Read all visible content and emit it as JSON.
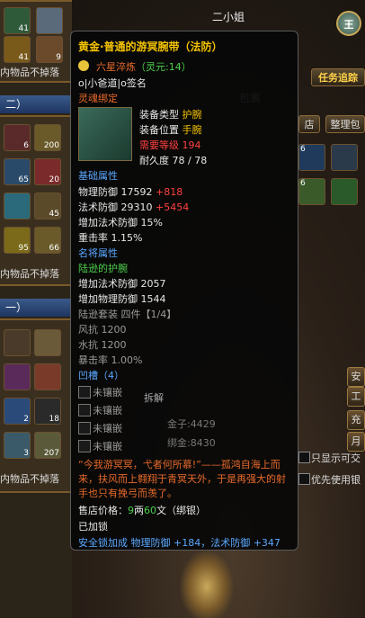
{
  "left": {
    "slots_top": [
      {
        "n": "41"
      },
      {
        "n": "9"
      },
      {
        "n": ""
      }
    ],
    "no_loss_label_1": "内物品不掉落",
    "section_2_title": "二）",
    "slots_mid": [
      {
        "n": "6"
      },
      {
        "n": "200"
      },
      {
        "n": "65"
      },
      {
        "n": "20"
      },
      {
        "n": "45"
      },
      {
        "n": "95"
      },
      {
        "n": "66"
      }
    ],
    "no_loss_label_2": "内物品不掉落",
    "section_1_title": "一）",
    "slots_low": [
      {
        "n": ""
      },
      {
        "n": ""
      },
      {
        "n": ""
      },
      {
        "n": ""
      },
      {
        "n": "2"
      },
      {
        "n": "18"
      },
      {
        "n": "3"
      },
      {
        "n": "207"
      }
    ],
    "no_loss_label_3": "内物品不掉落"
  },
  "bag": {
    "window_title": "二小姐",
    "quest_button": "任务追踪",
    "bag_title": "包裹",
    "shop_btn": "店",
    "sort_btn": "整理包",
    "safe_btn": "安全",
    "side_btns": [
      "工",
      "充",
      "月"
    ],
    "gold_label": "金子:4429",
    "silver_label": "绑金:8430",
    "only_tradeable": "只显示可交",
    "prefer_bound": "优先使用银",
    "split_label": "拆解",
    "seal_label": "王"
  },
  "tooltip": {
    "title": "黄金·普通的游冥腕带（法防）",
    "refine": "六星淬炼",
    "spirit": "（灵元:14）",
    "owner": "o|小爸道|o签名",
    "soul_bound": "灵魂绑定",
    "equip_type_label": "装备类型",
    "equip_type_value": "护腕",
    "equip_slot_label": "装备位置",
    "equip_slot_value": "手腕",
    "req_level_label": "需要等级",
    "req_level_value": "194",
    "durability_label": "耐久度",
    "durability_value": "78 / 78",
    "base_attr_title": "基础属性",
    "phys_def_label": "物理防御",
    "phys_def_value": "17592",
    "phys_def_bonus": "+818",
    "mag_def_label": "法术防御",
    "mag_def_value": "29310",
    "mag_def_bonus": "+5454",
    "mag_def_pct": "增加法术防御 15%",
    "crit": "重击率  1.15%",
    "famous_title": "名将属性",
    "famous_name": "陆逊的护腕",
    "famous_line1": "增加法术防御 2057",
    "famous_line2": "增加物理防御 1544",
    "set_name": "陆逊套装  四件【1/4】",
    "wind_res": "风抗  1200",
    "water_res": "水抗  1200",
    "crit_rate": "暴击率  1.00%",
    "socket_title": "凹槽",
    "socket_count": "（4）",
    "sockets": [
      "未镶嵌",
      "未镶嵌",
      "未镶嵌",
      "未镶嵌"
    ],
    "quote": "“今我游冥冥，弋者何所慕!”——孤鸿自海上而来，扶风而上翱翔于青冥天外，于是再强大的射手也只有挽弓而羡了。",
    "price_label": "售店价格：",
    "price_liang": "9",
    "price_liang_unit": "两",
    "price_wen": "60",
    "price_wen_unit": "文",
    "price_bind": "（绑银）",
    "locked": "已加锁",
    "footer": "安全锁加成  物理防御 +184，法术防御 +347"
  }
}
